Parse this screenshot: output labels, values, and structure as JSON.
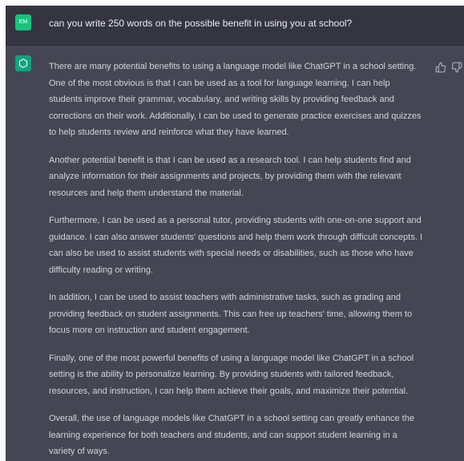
{
  "user": {
    "avatar_initials": "EM",
    "message": "can you write 250 words on the possible benefit in using you at school?"
  },
  "assistant": {
    "paragraphs": [
      "There are many potential benefits to using a language model like ChatGPT in a school setting. One of the most obvious is that I can be used as a tool for language learning. I can help students improve their grammar, vocabulary, and writing skills by providing feedback and corrections on their work. Additionally, I can be used to generate practice exercises and quizzes to help students review and reinforce what they have learned.",
      "Another potential benefit is that I can be used as a research tool. I can help students find and analyze information for their assignments and projects, by providing them with the relevant resources and help them understand the material.",
      "Furthermore, I can be used as a personal tutor, providing students with one-on-one support and guidance. I can also answer students' questions and help them work through difficult concepts. I can also be used to assist students with special needs or disabilities, such as those who have difficulty reading or writing.",
      "In addition, I can be used to assist teachers with administrative tasks, such as grading and providing feedback on student assignments. This can free up teachers' time, allowing them to focus more on instruction and student engagement.",
      "Finally, one of the most powerful benefits of using a language model like ChatGPT in a school setting is the ability to personalize learning. By providing students with tailored feedback, resources, and instruction, I can help them achieve their goals, and maximize their potential.",
      "Overall, the use of language models like ChatGPT in a school setting can greatly enhance the learning experience for both teachers and students, and can support student learning in a variety of ways."
    ]
  },
  "icons": {
    "assistant_avatar": "openai-logo-icon",
    "feedback_up": "thumbs-up-icon",
    "feedback_down": "thumbs-down-icon"
  },
  "colors": {
    "user_background": "#343541",
    "assistant_background": "#444654",
    "user_avatar": "#19c37d",
    "assistant_avatar": "#10a37f"
  }
}
